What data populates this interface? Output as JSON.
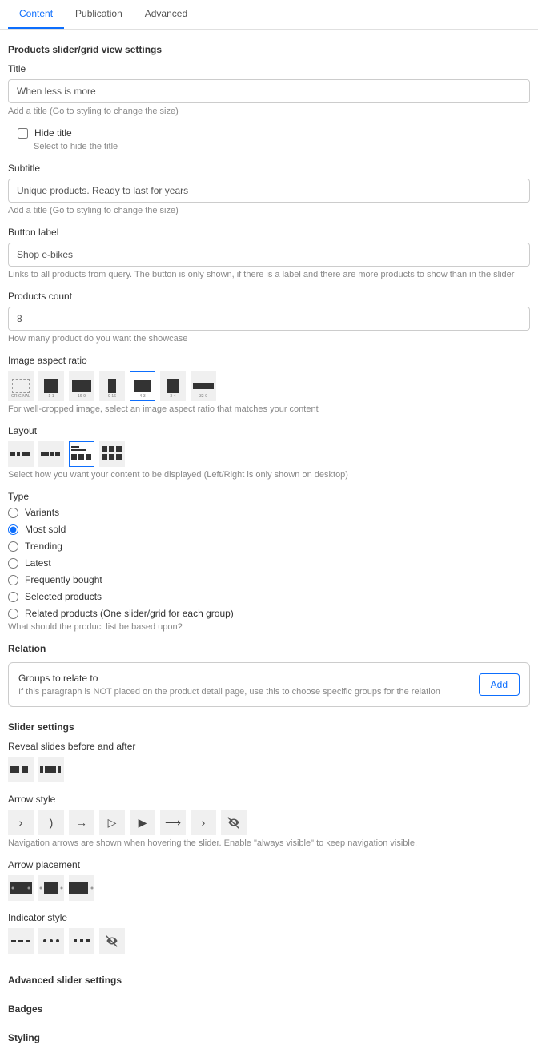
{
  "tabs": {
    "content": "Content",
    "publication": "Publication",
    "advanced": "Advanced"
  },
  "section_header": "Products slider/grid view settings",
  "title_field": {
    "label": "Title",
    "value": "When less is more",
    "help": "Add a title (Go to styling to change the size)"
  },
  "hide_title": {
    "label": "Hide title",
    "help": "Select to hide the title"
  },
  "subtitle_field": {
    "label": "Subtitle",
    "value": "Unique products. Ready to last for years",
    "help": "Add a title (Go to styling to change the size)"
  },
  "button_label": {
    "label": "Button label",
    "value": "Shop e-bikes",
    "help": "Links to all products from query. The button is only shown, if there is a label and there are more products to show than in the slider"
  },
  "products_count": {
    "label": "Products count",
    "value": "8",
    "help": "How many product do you want the showcase"
  },
  "aspect_ratio": {
    "label": "Image aspect ratio",
    "help": "For well-cropped image, select an image aspect ratio that matches your content",
    "original_label": "ORIGINAL",
    "r11": "1-1",
    "r169": "16-9",
    "r916": "9-16",
    "r43": "4-3",
    "r34": "3-4",
    "r329": "32-9"
  },
  "layout": {
    "label": "Layout",
    "help": "Select how you want your content to be displayed (Left/Right is only shown on desktop)"
  },
  "type": {
    "label": "Type",
    "variants": "Variants",
    "most_sold": "Most sold",
    "trending": "Trending",
    "latest": "Latest",
    "frequently_bought": "Frequently bought",
    "selected_products": "Selected products",
    "related_products": "Related products (One slider/grid for each group)",
    "help": "What should the product list be based upon?"
  },
  "relation": {
    "label": "Relation",
    "box_title": "Groups to relate to",
    "box_help": "If this paragraph is NOT placed on the product detail page, use this to choose specific groups for the relation",
    "add_button": "Add"
  },
  "slider_settings": {
    "header": "Slider settings",
    "reveal_label": "Reveal slides before and after",
    "arrow_style_label": "Arrow style",
    "arrow_help": "Navigation arrows are shown when hovering the slider. Enable \"always visible\" to keep navigation visible.",
    "arrow_placement_label": "Arrow placement",
    "indicator_style_label": "Indicator style"
  },
  "collapsed_sections": {
    "advanced_slider": "Advanced slider settings",
    "badges": "Badges",
    "styling": "Styling"
  }
}
